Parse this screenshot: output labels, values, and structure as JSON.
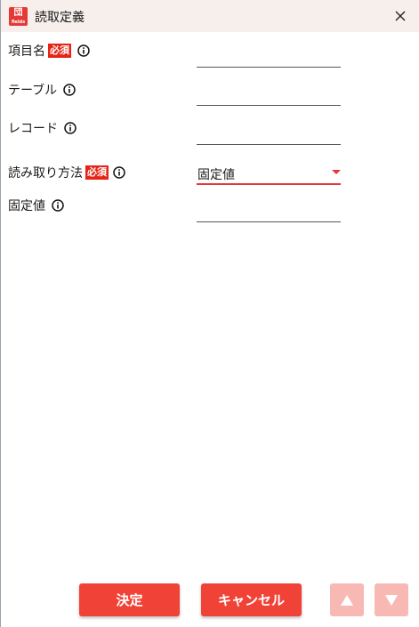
{
  "window": {
    "title": "読取定義",
    "logo_text_1": "団",
    "logo_text_2": "fields"
  },
  "fields": {
    "item_name": {
      "label": "項目名",
      "required_badge": "必須",
      "value": ""
    },
    "table": {
      "label": "テーブル",
      "value": ""
    },
    "record": {
      "label": "レコード",
      "value": ""
    },
    "read_method": {
      "label": "読み取り方法",
      "required_badge": "必須",
      "selected": "固定値"
    },
    "fixed_value": {
      "label": "固定値",
      "value": ""
    }
  },
  "footer": {
    "confirm_label": "決定",
    "cancel_label": "キャンセル",
    "move_up_icon": "triangle-up-icon",
    "move_down_icon": "triangle-down-icon"
  },
  "colors": {
    "accent": "#f04237",
    "badge": "#e52416",
    "titlebar": "#f6efec",
    "disabled_arrow": "#f8b9b4"
  }
}
